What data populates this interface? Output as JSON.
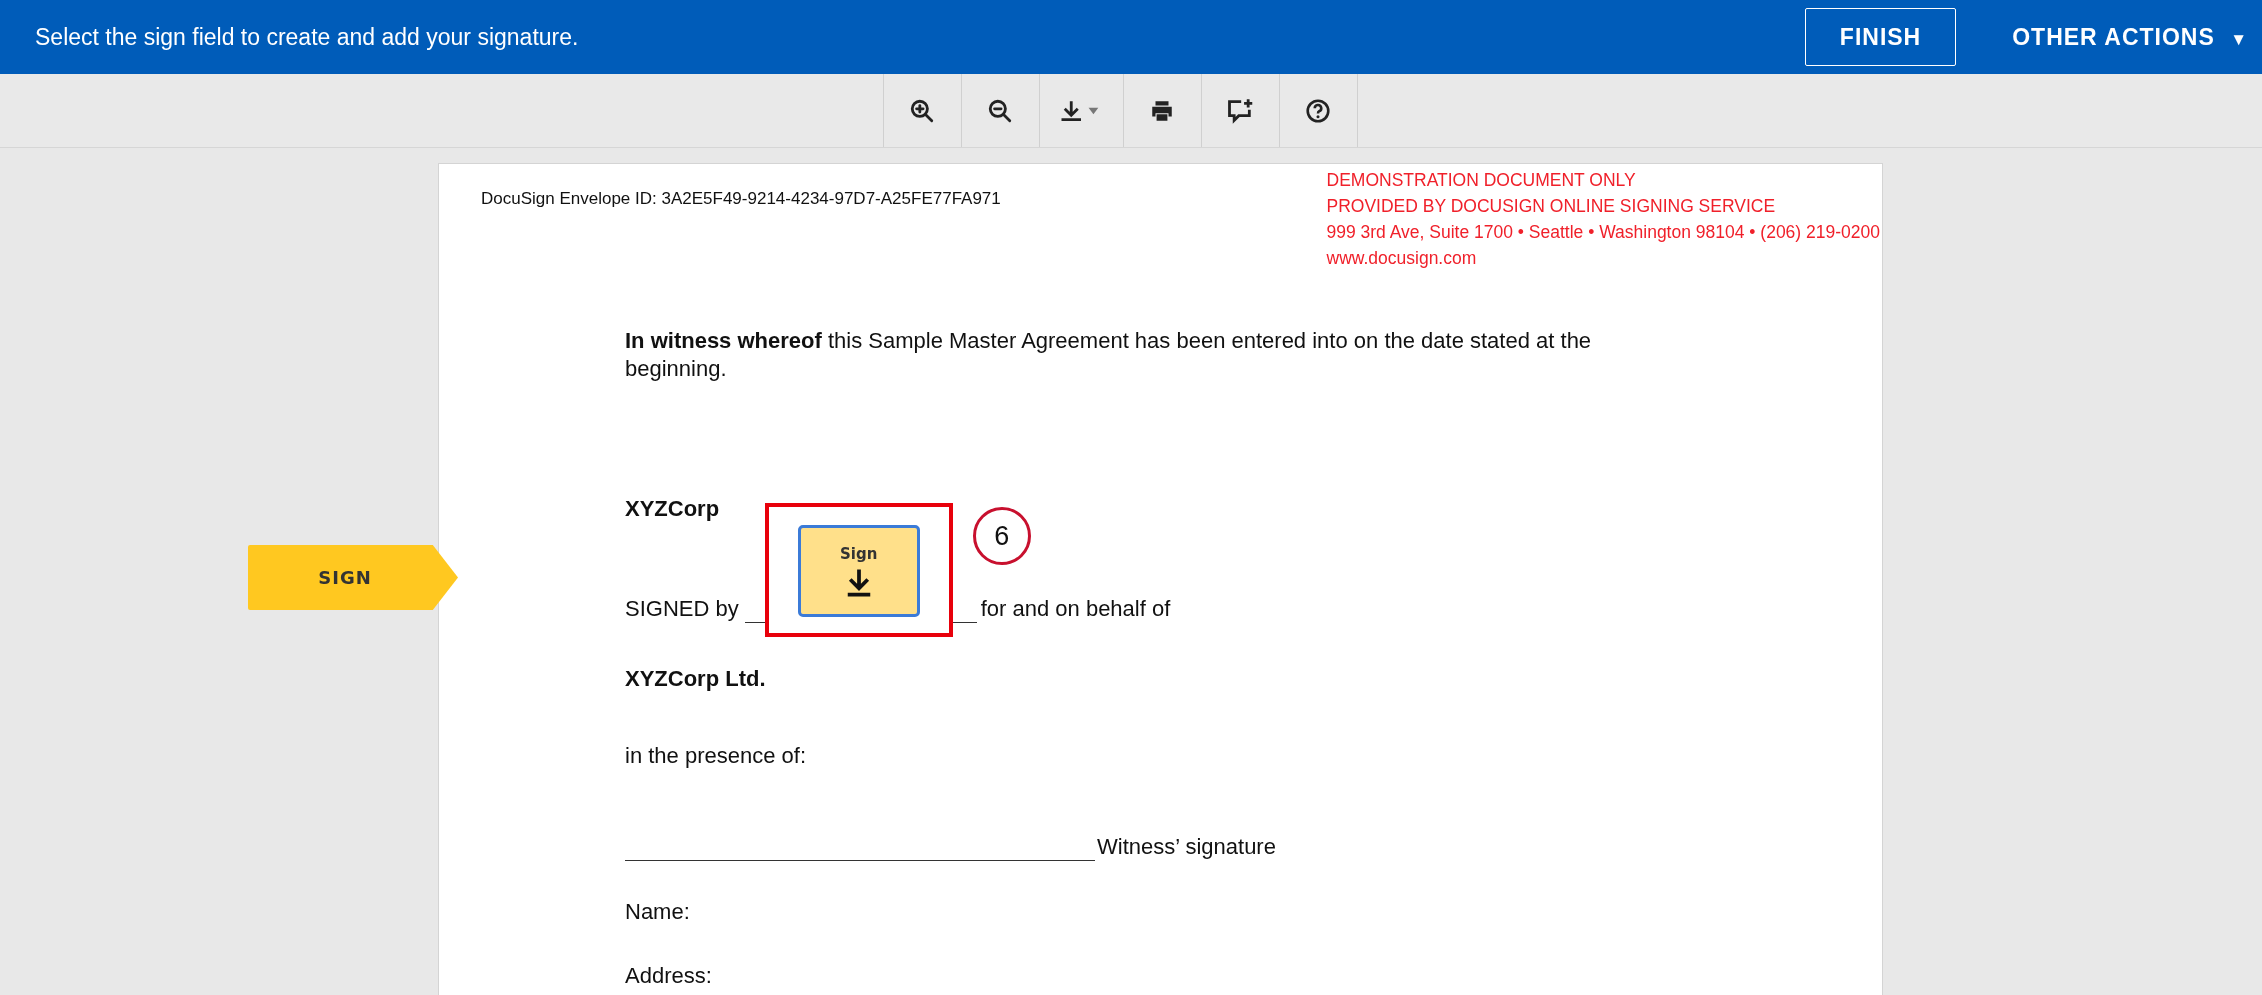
{
  "header": {
    "message": "Select the sign field to create and add your signature.",
    "buttons": [
      {
        "label": "FINISH",
        "kind": "outline"
      },
      {
        "label": "OTHER ACTIONS",
        "kind": "menu",
        "caret": "▼"
      }
    ]
  },
  "toolbar": {
    "tools": [
      {
        "kind": "zoom-in"
      },
      {
        "kind": "zoom-out"
      },
      {
        "kind": "download"
      },
      {
        "kind": "print"
      },
      {
        "kind": "comment"
      },
      {
        "kind": "help"
      }
    ]
  },
  "sign_tag": {
    "label": "SIGN"
  },
  "document": {
    "envelope_id": "DocuSign Envelope ID: 3A2E5F49-9214-4234-97D7-A25FE77FA971",
    "notice": [
      "DEMONSTRATION DOCUMENT ONLY",
      "PROVIDED BY DOCUSIGN ONLINE SIGNING SERVICE",
      "999 3rd Ave, Suite 1700  • Seattle • Washington 98104 • (206) 219-0200",
      "www.docusign.com"
    ],
    "paragraph": "**In witness whereof** this Sample Master Agreement has been entered into on the date stated at the beginning.",
    "company": "XYZCorp",
    "signed_prefix": "SIGNED by",
    "signed_suffix": "for and on behalf of",
    "sign_field": {
      "label": "Sign"
    },
    "annotation": "6",
    "company_ltd": "XYZCorp Ltd.",
    "presence": "in the presence of:",
    "witness": "Witness’ signature",
    "name": "Name:",
    "address": "Address:"
  }
}
